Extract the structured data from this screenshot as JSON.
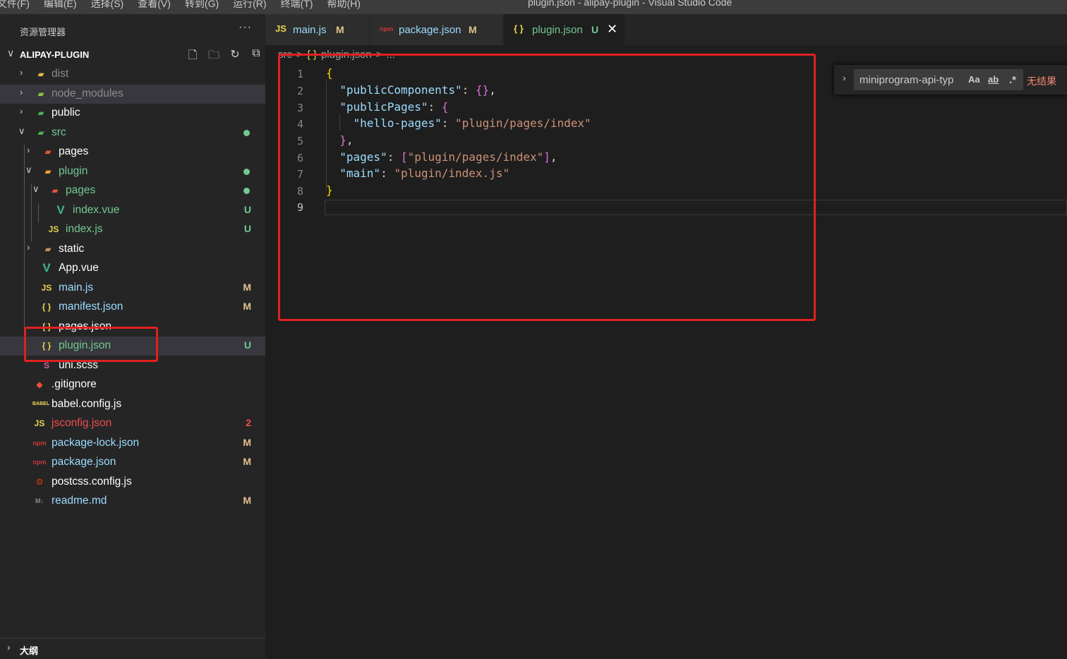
{
  "menu": [
    "文件(F)",
    "编辑(E)",
    "选择(S)",
    "查看(V)",
    "转到(G)",
    "运行(R)",
    "终端(T)",
    "帮助(H)"
  ],
  "window_title": "plugin.json - alipay-plugin - Visual Studio Code",
  "sidebar": {
    "title": "资源管理器",
    "more": "···",
    "section": "ALIPAY-PLUGIN",
    "items": [
      {
        "label": "dist",
        "icon": "JS",
        "type": "folder"
      },
      {
        "label": "node_modules",
        "icon": "JS",
        "type": "folder"
      },
      {
        "label": "public",
        "icon": "JS",
        "type": "folder"
      },
      {
        "label": "src",
        "icon": "JS",
        "type": "folder"
      },
      {
        "label": "pages",
        "icon": "JS",
        "type": "folder"
      },
      {
        "label": "plugin",
        "icon": "JS",
        "type": "folder"
      },
      {
        "label": "pages",
        "icon": "JS",
        "type": "folder"
      },
      {
        "label": "index.vue",
        "icon": "V",
        "badge": "U"
      },
      {
        "label": "index.js",
        "icon": "JS",
        "badge": "U"
      },
      {
        "label": "static",
        "icon": "JS",
        "type": "folder"
      },
      {
        "label": "App.vue",
        "icon": "V"
      },
      {
        "label": "main.js",
        "icon": "JS",
        "badge": "M"
      },
      {
        "label": "manifest.json",
        "icon": "{ }",
        "badge": "M"
      },
      {
        "label": "pages.json",
        "icon": "{ }"
      },
      {
        "label": "plugin.json",
        "icon": "{ }",
        "badge": "U"
      },
      {
        "label": "uni.scss",
        "icon": "S"
      },
      {
        "label": ".gitignore",
        "icon": "◆"
      },
      {
        "label": "babel.config.js",
        "icon": "BABEL"
      },
      {
        "label": "jsconfig.json",
        "icon": "JS",
        "badge": "2"
      },
      {
        "label": "package-lock.json",
        "icon": "npm",
        "badge": "M"
      },
      {
        "label": "package.json",
        "icon": "npm",
        "badge": "M"
      },
      {
        "label": "postcss.config.js",
        "icon": "⚙"
      },
      {
        "label": "readme.md",
        "icon": "M↓",
        "badge": "M"
      }
    ],
    "outline": "大纲"
  },
  "tabs": [
    {
      "icon": "JS",
      "label": "main.js",
      "mark": "M"
    },
    {
      "icon": "npm",
      "label": "package.json",
      "mark": "M"
    },
    {
      "icon": "{ }",
      "label": "plugin.json",
      "mark": "U",
      "close": "✕"
    }
  ],
  "breadcrumb": [
    "src",
    ">",
    "{ }",
    "plugin.json",
    ">",
    "..."
  ],
  "code": {
    "line_numbers": [
      "1",
      "2",
      "3",
      "4",
      "5",
      "6",
      "7",
      "8",
      "9"
    ]
  },
  "find": {
    "value": "miniprogram-api-typ",
    "opt_case": "Aa",
    "opt_word": "ab",
    "opt_regex": ".*",
    "no_results": "无结果"
  },
  "colors": {
    "modified": "#e2c08d",
    "untracked": "#73c991",
    "error": "#f14c4c",
    "annotation": "#e02020"
  }
}
